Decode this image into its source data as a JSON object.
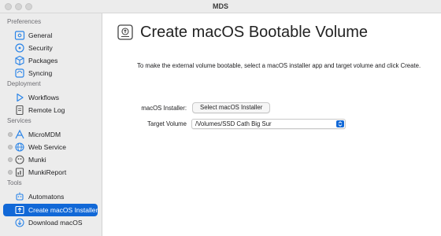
{
  "window": {
    "title": "MDS"
  },
  "sidebar": {
    "sections": [
      {
        "title": "Preferences"
      },
      {
        "title": "Deployment"
      },
      {
        "title": "Services"
      },
      {
        "title": "Tools"
      }
    ],
    "items": [
      {
        "label": "General",
        "icon": "general-gear-icon"
      },
      {
        "label": "Security",
        "icon": "security-shield-icon"
      },
      {
        "label": "Packages",
        "icon": "package-box-icon"
      },
      {
        "label": "Syncing",
        "icon": "sync-arrows-icon"
      },
      {
        "label": "Workflows",
        "icon": "workflow-play-icon"
      },
      {
        "label": "Remote Log",
        "icon": "remote-log-document-icon"
      },
      {
        "label": "MicroMDM",
        "icon": "micromdm-icon",
        "status": "inactive"
      },
      {
        "label": "Web Service",
        "icon": "web-service-globe-icon",
        "status": "inactive"
      },
      {
        "label": "Munki",
        "icon": "munki-icon",
        "status": "inactive"
      },
      {
        "label": "MunkiReport",
        "icon": "munkireport-icon",
        "status": "inactive"
      },
      {
        "label": "Automatons",
        "icon": "automaton-robot-icon"
      },
      {
        "label": "Create macOS Installer",
        "icon": "create-installer-icon",
        "selected": true
      },
      {
        "label": "Download macOS",
        "icon": "download-macos-icon"
      }
    ]
  },
  "main": {
    "title": "Create macOS Bootable Volume",
    "header_icon": "bootable-drive-icon",
    "description": "To make the external volume bootable, select a macOS installer app and target volume and click Create.",
    "installer": {
      "label": "macOS Installer:",
      "button_label": "Select macOS Installer"
    },
    "target": {
      "label": "Target Volume",
      "value": "/Volumes/SSD Cath Big Sur"
    }
  },
  "colors": {
    "accent": "#1168d7",
    "sidebar_bg": "#ececec",
    "titlebar_bg": "#ececec"
  }
}
